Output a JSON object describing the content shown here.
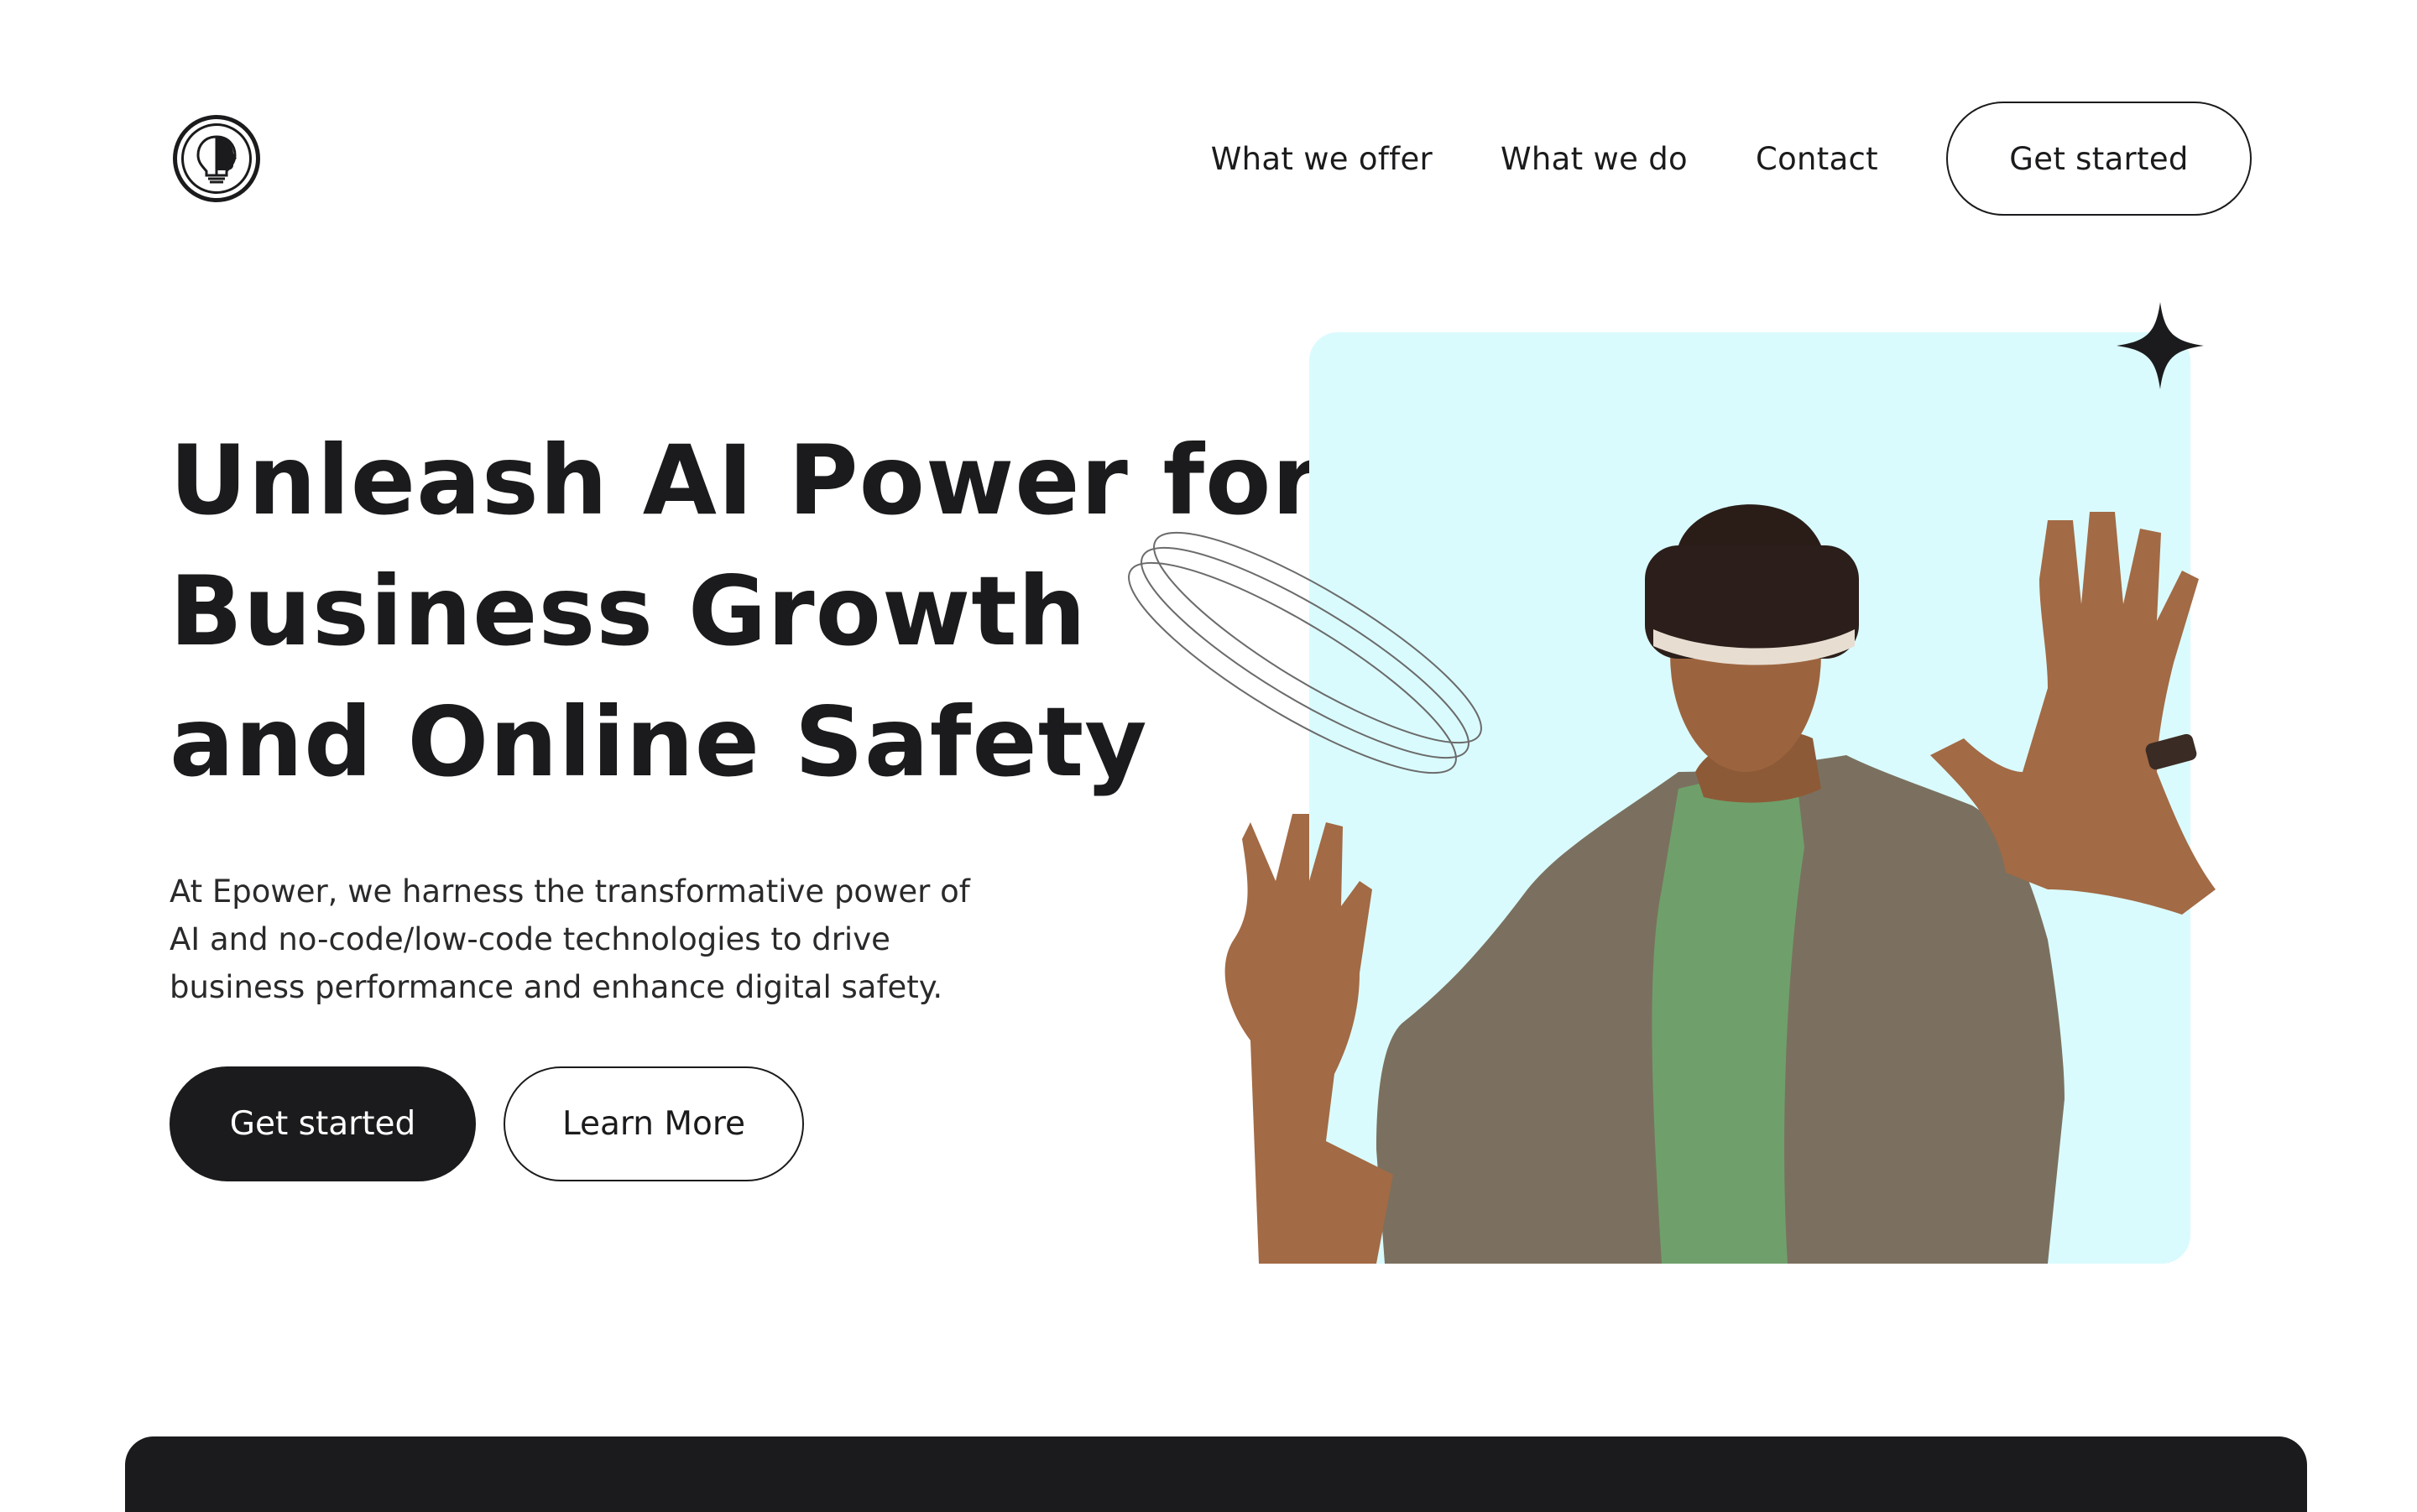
{
  "brand": {
    "logo_icon": "lightbulb-face-icon"
  },
  "nav": {
    "links": [
      "What we offer",
      "What we do",
      "Contact"
    ],
    "cta_label": "Get started"
  },
  "hero": {
    "title_lines": [
      "Unleash AI Power for",
      "Business Growth",
      "and Online Safety"
    ],
    "description_lines": [
      "At Epower, we harness the transformative power of",
      "AI and no-code/low-code technologies to drive",
      "business performance and enhance digital safety."
    ],
    "primary_button": "Get started",
    "secondary_button": "Learn More"
  },
  "colors": {
    "ink": "#1b1b1d",
    "card_background": "#dafbfd",
    "shirt": "#7b705f",
    "tee": "#6fa06b",
    "skin": "#a26a45"
  },
  "icons": {
    "sparkle": "sparkle-icon",
    "orbit": "orbit-rings-icon"
  }
}
